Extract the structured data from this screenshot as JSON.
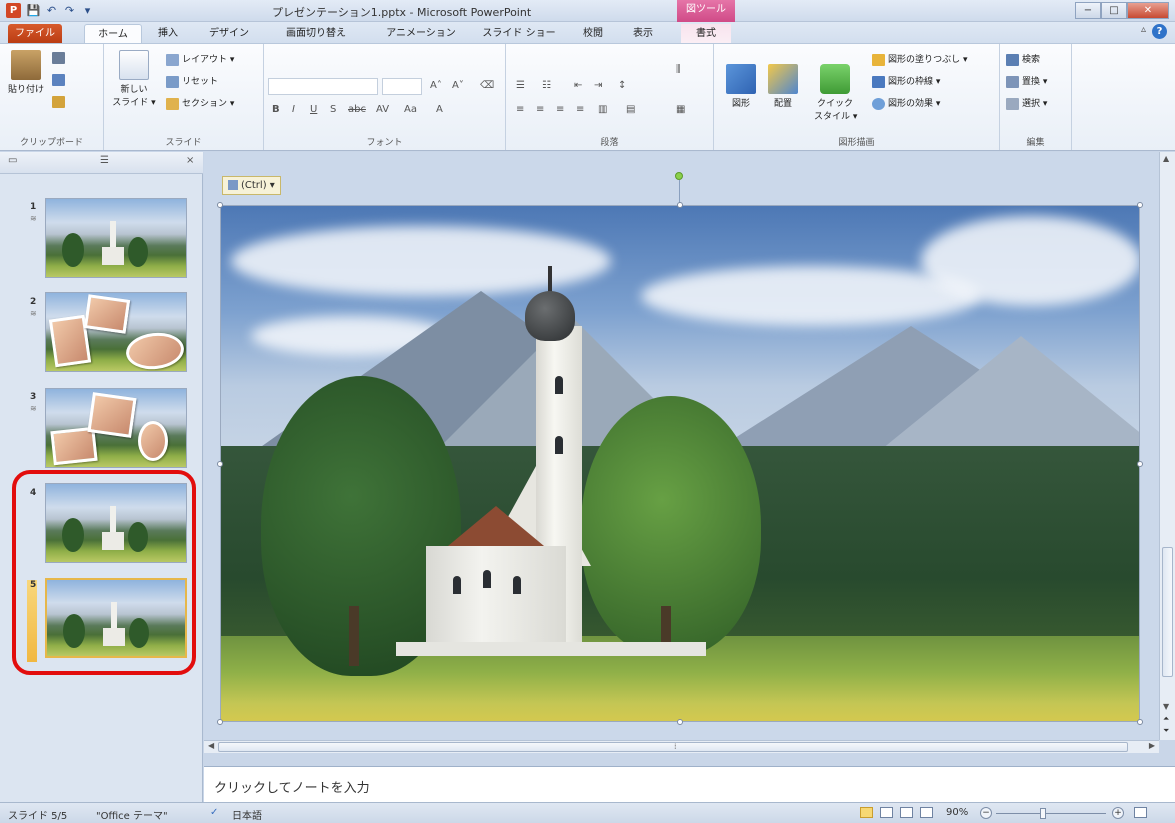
{
  "titlebar": {
    "app_letter": "P",
    "title": "プレゼンテーション1.pptx - Microsoft PowerPoint",
    "context_tool": "図ツール",
    "quick_access": [
      "💾",
      "↶",
      "↷",
      "▾"
    ]
  },
  "tabs": {
    "file": "ファイル",
    "home": "ホーム",
    "insert": "挿入",
    "design": "デザイン",
    "transitions": "画面切り替え",
    "animations": "アニメーション",
    "slideshow": "スライド ショー",
    "review": "校閲",
    "view": "表示",
    "format": "書式"
  },
  "ribbon": {
    "clipboard": {
      "paste": "貼り付け",
      "label": "クリップボード"
    },
    "slides": {
      "new_slide_line1": "新しい",
      "new_slide_line2": "スライド ▾",
      "layout": "レイアウト ▾",
      "reset": "リセット",
      "section": "セクション ▾",
      "label": "スライド"
    },
    "font": {
      "label": "フォント"
    },
    "paragraph": {
      "label": "段落"
    },
    "drawing": {
      "shapes": "図形",
      "arrange": "配置",
      "quick_styles_line1": "クイック",
      "quick_styles_line2": "スタイル ▾",
      "fill": "図形の塗りつぶし ▾",
      "outline": "図形の枠線 ▾",
      "effects": "図形の効果 ▾",
      "label": "図形描画"
    },
    "editing": {
      "find": "検索",
      "replace": "置換 ▾",
      "select": "選択 ▾",
      "label": "編集"
    }
  },
  "panel": {
    "tabs_close": "×",
    "slides": [
      {
        "num": "1"
      },
      {
        "num": "2"
      },
      {
        "num": "3"
      },
      {
        "num": "4"
      },
      {
        "num": "5"
      }
    ]
  },
  "editor": {
    "paste_options": "(Ctrl) ▾",
    "notes_placeholder": "クリックしてノートを入力"
  },
  "status": {
    "slide_indicator": "スライド 5/5",
    "theme": "\"Office テーマ\"",
    "language": "日本語",
    "zoom": "90%",
    "zoom_minus": "−",
    "zoom_plus": "+"
  },
  "colors": {
    "file_tab": "#c74a1b",
    "context_tab": "#d04a87",
    "selection_ring": "#e20d0d",
    "selected_thumb": "#f1b841"
  }
}
